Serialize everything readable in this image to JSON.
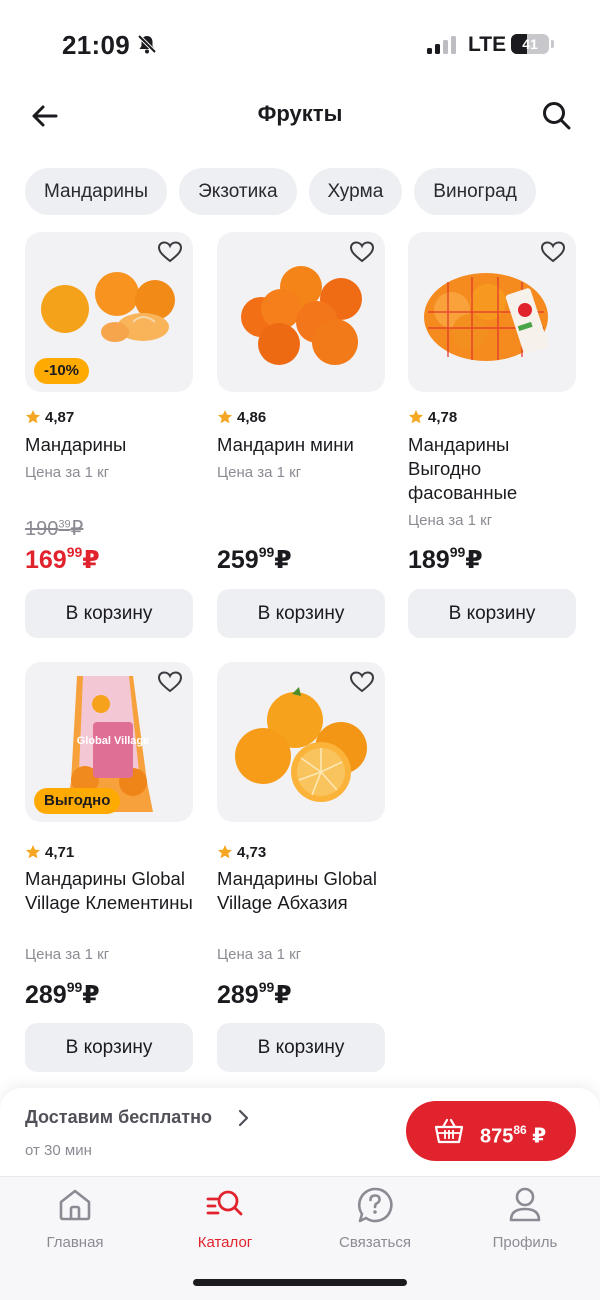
{
  "status_bar": {
    "time": "21:09",
    "network": "LTE",
    "battery": "41",
    "battery_level": 0.41
  },
  "header": {
    "title": "Фрукты",
    "back_icon": "arrow-left-icon",
    "search_icon": "search-icon"
  },
  "chips": [
    "Мандарины",
    "Экзотика",
    "Хурма",
    "Виноград"
  ],
  "products": [
    {
      "rating": "4,87",
      "name": "Мандарины",
      "unit": "Цена за 1 кг",
      "old_price_int": "190",
      "old_price_dec": "39",
      "old_price_cur": "₽",
      "price_int": "169",
      "price_dec": "99",
      "price_cur": "₽",
      "badge": "-10%",
      "cart": "В корзину",
      "price_color": "#e1232e"
    },
    {
      "rating": "4,86",
      "name": "Мандарин мини",
      "unit": "Цена за 1 кг",
      "price_int": "259",
      "price_dec": "99",
      "price_cur": "₽",
      "cart": "В корзину"
    },
    {
      "rating": "4,78",
      "name": "Мандарины Выгодно фасованные",
      "unit": "Цена за 1 кг",
      "price_int": "189",
      "price_dec": "99",
      "price_cur": "₽",
      "cart": "В корзину"
    },
    {
      "rating": "4,71",
      "name": "Мандарины Global Village Клементины",
      "unit": "Цена за 1 кг",
      "price_int": "289",
      "price_dec": "99",
      "price_cur": "₽",
      "badge": "Выгодно",
      "cart": "В корзину",
      "package_brand": "Global Village"
    },
    {
      "rating": "4,73",
      "name": "Мандарины Global Village Абхазия",
      "unit": "Цена за 1 кг",
      "price_int": "289",
      "price_dec": "99",
      "price_cur": "₽",
      "cart": "В корзину"
    }
  ],
  "delivery": {
    "title": "Доставим бесплатно",
    "subtitle": "от 30 мин",
    "basket_int": "875",
    "basket_dec": "86",
    "basket_cur": "₽"
  },
  "tabs": [
    {
      "label": "Главная",
      "icon": "home-icon"
    },
    {
      "label": "Каталог",
      "icon": "catalog-search-icon",
      "active": true
    },
    {
      "label": "Связаться",
      "icon": "help-chat-icon"
    },
    {
      "label": "Профиль",
      "icon": "profile-icon"
    }
  ],
  "colors": {
    "accent": "#e1232e",
    "badge": "#ffaa00",
    "star": "#f5a623",
    "chip_bg": "#eeeff2",
    "card_bg": "#f2f2f5",
    "orange": "#f7931e"
  }
}
